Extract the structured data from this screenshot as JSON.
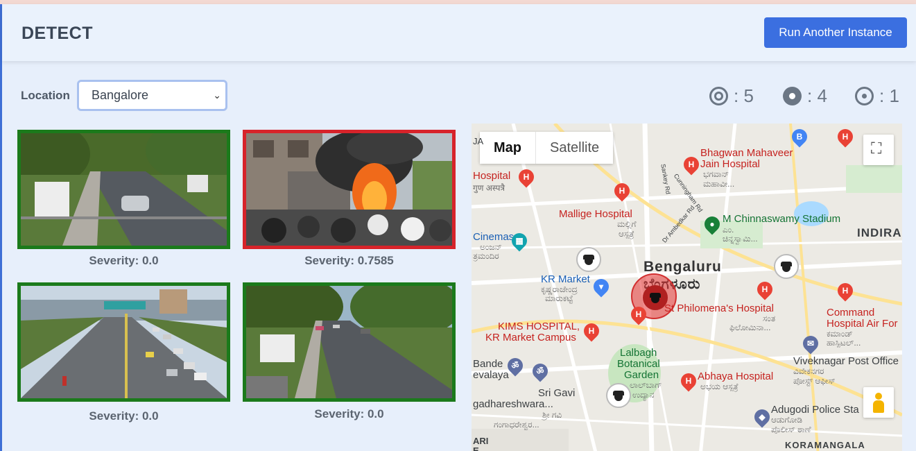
{
  "header": {
    "title": "DETECT",
    "run_button": "Run Another Instance"
  },
  "location": {
    "label": "Location",
    "selected": "Bangalore"
  },
  "counts": [
    {
      "icon": "double-ring-icon",
      "value": ": 5"
    },
    {
      "icon": "filled-ring-icon",
      "value": ": 4"
    },
    {
      "icon": "dot-ring-icon",
      "value": ": 1"
    }
  ],
  "feeds": [
    {
      "severity": "Severity: 0.0",
      "status_color": "#1b7a1b"
    },
    {
      "severity": "Severity: 0.7585",
      "status_color": "#d7232a"
    },
    {
      "severity": "Severity: 0.0",
      "status_color": "#1b7a1b"
    },
    {
      "severity": "Severity: 0.0",
      "status_color": "#1b7a1b"
    }
  ],
  "map": {
    "tabs": [
      "Map",
      "Satellite"
    ],
    "labels": {
      "bhagwan": "Bhagwan Mahaveer",
      "bhagwan2": "Jain Hospital",
      "bhagwan_kn": "ಭಗವಾನ್",
      "bhagwan_kn2": "ಮಹಾವೀ...",
      "hospital": "Hospital",
      "hospital_kn": "गुण अस्पत्रै",
      "mallige": "Mallige Hospital",
      "mallige_kn": "ಮಲ್ಲಿಗೆ",
      "mallige_kn2": "ಆಸ್ಪತ್ರೆ",
      "chinnaswamy": "M Chinnaswamy Stadium",
      "chinnaswamy_kn": "ಎಂ.",
      "chinnaswamy_kn2": "ಚಿನ್ನಸ್ವಾಮಿ...",
      "indira": "INDIRA",
      "cinemas": "Cinemas",
      "cinemas_kn": "ಅಂಜನ್",
      "cinemas_kn2": "ತ್ರಮಂದಿರ",
      "bengaluru": "Bengaluru",
      "bengaluru_kn": "ಬೆಂಗಳೂರು",
      "krmarket": "KR Market",
      "krmarket_kn": "ಕೃಷ್ಣರಾಜೇಂದ್ರ",
      "krmarket_kn2": "ಮಾರುಕಟ್ಟೆ",
      "philomena": "St Philomena's Hospital",
      "philomena_kn": "ಸಂತ",
      "philomena_kn2": "ಫಿಲೋಮಿನಾ...",
      "command": "Command",
      "command2": "Hospital Air For",
      "command_kn": "ಕಮಾಂಡ್",
      "command_kn2": "ಹಾಸ್ಪಿಟಲ್...",
      "kims": "KIMS HOSPITAL,",
      "kims2": "KR Market Campus",
      "bande": "Bande",
      "bande2": "evalaya",
      "lalbagh": "Lalbagh",
      "lalbagh2": "Botanical",
      "lalbagh3": "Garden",
      "lalbagh_kn": "ಲಾಲ್‌ಬಾಗ್",
      "lalbagh_kn2": "ಉದ್ಯಾನ",
      "abhaya": "Abhaya Hospital",
      "abhaya_kn": "ಅಭಯ ಆಸ್ಪತ್ರೆ",
      "viveknagar": "Viveknagar Post Office",
      "viveknagar_kn": "ವಿವೇಕನಗರ",
      "viveknagar_kn2": "ಪೋಸ್ಟ್ ಆಫೀಸ್",
      "srigavi": "Sri Gavi",
      "gadhareshwara": "gadhareshwara...",
      "srigavi_kn": "ಶ್ರೀ ಗವಿ",
      "srigavi_kn2": "ಗಂಗಾಧರೇಶ್ವರ...",
      "adugodi": "Adugodi Police Sta",
      "adugodi_kn": "ಆಡುಗೋಡಿ",
      "adugodi_kn2": "ಪೊಲೀಸ್ ಠಾಣೆ",
      "koramangala": "KORAMANGALA",
      "ari": "ARI",
      "e": "E",
      "ja": "JA",
      "cunningham": "Cunningham Rd",
      "ambedkar": "Dr Ambedkar Rd",
      "sankey": "Sankey Rd"
    }
  }
}
